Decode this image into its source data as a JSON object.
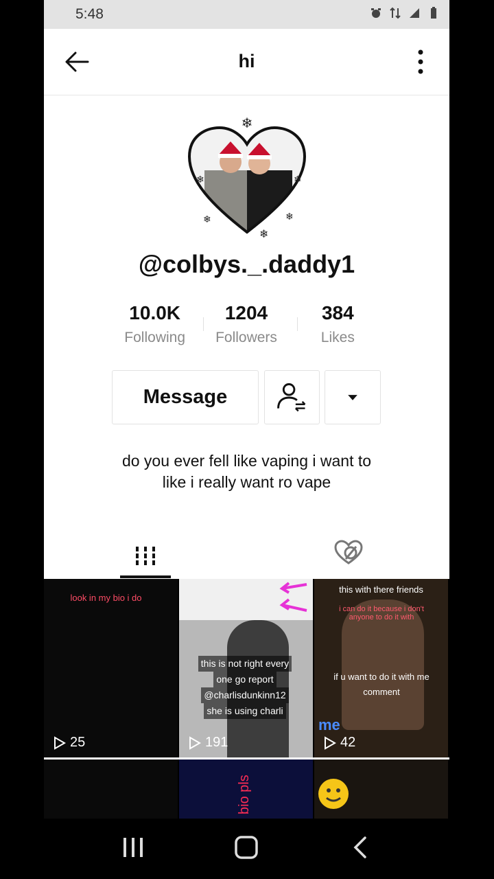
{
  "status": {
    "time": "5:48"
  },
  "header": {
    "title": "hi"
  },
  "profile": {
    "username": "@colbys._.daddy1",
    "stats": [
      {
        "value": "10.0K",
        "label": "Following"
      },
      {
        "value": "1204",
        "label": "Followers"
      },
      {
        "value": "384",
        "label": "Likes"
      }
    ],
    "message_label": "Message",
    "bio_line1": "do you ever fell like vaping i want to",
    "bio_line2": "like i really want ro vape"
  },
  "videos": [
    {
      "count": "25",
      "caption": "look in my bio i do"
    },
    {
      "count": "191",
      "lines": [
        "this is not right every",
        "one go report",
        "@charlisdunkinn12",
        "she is using charli"
      ]
    },
    {
      "count": "42",
      "top": "this with there friends",
      "mid": "i can do it because i don't anyone to do it with",
      "low": "if u want to do it with me comment",
      "me": "me"
    },
    {
      "caption": ""
    },
    {
      "caption": "bio pls"
    },
    {
      "caption": ""
    }
  ],
  "colors": {
    "accent_red": "#e0263c",
    "text": "#111111",
    "muted": "#8a8a8a"
  }
}
